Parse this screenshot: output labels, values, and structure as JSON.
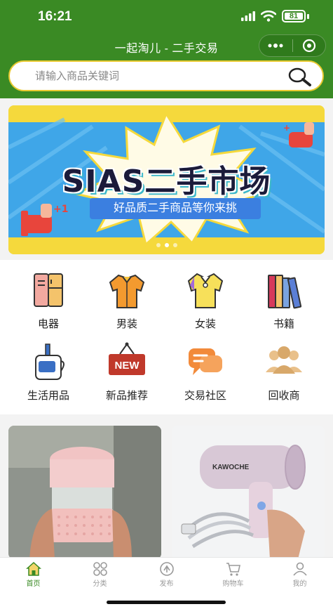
{
  "status_bar": {
    "time": "16:21",
    "battery": "81"
  },
  "navbar": {
    "title": "一起淘儿 - 二手交易"
  },
  "search": {
    "placeholder": "请输入商品关键词"
  },
  "banner": {
    "title": "SIAS二手市场",
    "subtitle": "好品质二手商品等你来挑",
    "slides_count": 3,
    "active_slide": 1
  },
  "categories": [
    {
      "label": "电器",
      "icon": "appliance-icon"
    },
    {
      "label": "男装",
      "icon": "mens-shirt-icon"
    },
    {
      "label": "女装",
      "icon": "womens-shirt-icon"
    },
    {
      "label": "书籍",
      "icon": "books-icon"
    },
    {
      "label": "生活用品",
      "icon": "toothbrush-cup-icon"
    },
    {
      "label": "新品推荐",
      "icon": "new-sign-icon"
    },
    {
      "label": "交易社区",
      "icon": "chat-bubbles-icon"
    },
    {
      "label": "回收商",
      "icon": "people-group-icon"
    }
  ],
  "products": [
    {
      "name": "pink-glass-cup",
      "image": "pink glass coffee cup"
    },
    {
      "name": "kawoche-hair-dryer",
      "brand": "KAWOCHE",
      "image": "pink hair dryer"
    }
  ],
  "tabbar": [
    {
      "label": "首页",
      "icon": "home-icon",
      "active": true
    },
    {
      "label": "分类",
      "icon": "category-icon",
      "active": false
    },
    {
      "label": "发布",
      "icon": "publish-icon",
      "active": false
    },
    {
      "label": "购物车",
      "icon": "cart-icon",
      "active": false
    },
    {
      "label": "我的",
      "icon": "profile-icon",
      "active": false
    }
  ],
  "colors": {
    "brand_green": "#3a8a24",
    "search_border": "#e8c92f",
    "banner_yellow": "#f5d93c",
    "banner_blue": "#3b7fe0"
  }
}
